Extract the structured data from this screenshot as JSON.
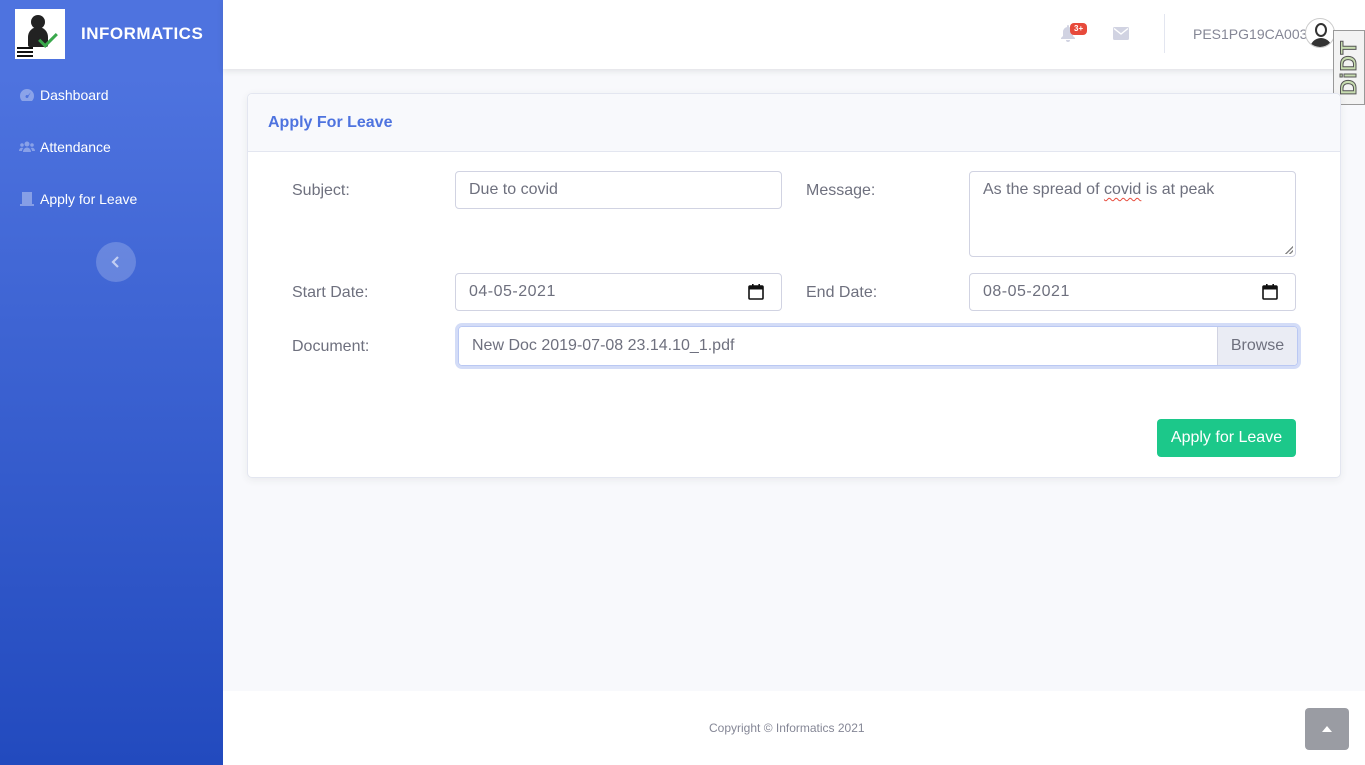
{
  "brand": {
    "name": "INFORMATICS"
  },
  "sidebar": {
    "items": [
      {
        "label": "Dashboard",
        "icon": "tachometer-icon"
      },
      {
        "label": "Attendance",
        "icon": "users-icon"
      },
      {
        "label": "Apply for Leave",
        "icon": "building-icon"
      }
    ],
    "toggle_icon": "chevron-left-icon"
  },
  "topbar": {
    "alerts_badge": "3+",
    "username": "PES1PG19CA003"
  },
  "extension": {
    "label": "DiDT"
  },
  "form": {
    "title": "Apply For Leave",
    "subject_label": "Subject:",
    "subject_value": "Due to covid",
    "message_label": "Message:",
    "message_value_prefix": "As the spread of ",
    "message_value_misspelled": "covid",
    "message_value_suffix": " is at peak",
    "start_label": "Start Date:",
    "start_value": "04-05-2021",
    "end_label": "End Date:",
    "end_value": "08-05-2021",
    "document_label": "Document:",
    "document_value": "New Doc 2019-07-08 23.14.10_1.pdf",
    "browse_label": "Browse",
    "submit_label": "Apply for Leave"
  },
  "footer": {
    "copyright": "Copyright © Informatics 2021"
  },
  "colors": {
    "primary": "#4e73df",
    "success": "#1cc88a",
    "danger": "#e74a3b"
  }
}
